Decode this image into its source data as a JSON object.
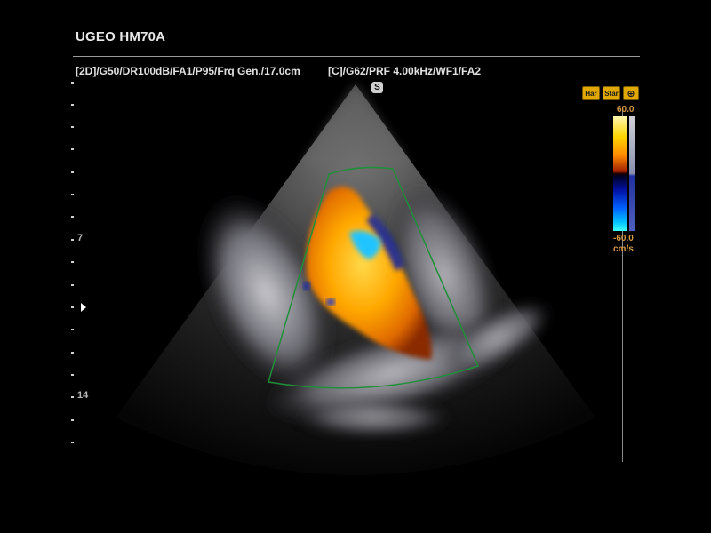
{
  "header": {
    "title": "UGEO HM70A",
    "params_2d": "[2D]/G50/DR100dB/FA1/P95/Frq Gen./17.0cm",
    "params_color": "[C]/G62/PRF 4.00kHz/WF1/FA2"
  },
  "depth_scale": {
    "labels": [
      "7",
      "14"
    ]
  },
  "image": {
    "orientation_marker": "S"
  },
  "toolbar": {
    "har_label": "Har",
    "star_label": "Star",
    "globe_icon": "globe-icon"
  },
  "color_scale": {
    "max": "60.0",
    "min": "-60.0",
    "unit": "cm/s"
  },
  "colors": {
    "doppler_positive": "#ff9a00",
    "doppler_negative": "#00b8ff",
    "roi_box": "#1f8f3a",
    "text": "#e0e0e0",
    "scale_label": "#d79a45"
  }
}
